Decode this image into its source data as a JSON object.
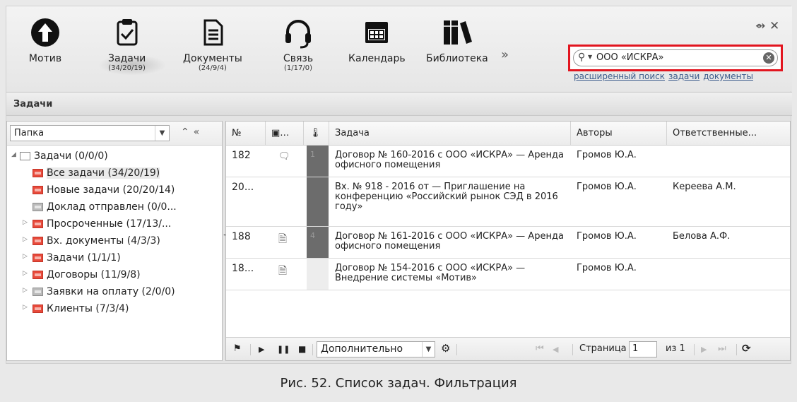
{
  "toolbar": {
    "buttons": [
      {
        "label": "Мотив",
        "count": ""
      },
      {
        "label": "Задачи",
        "count": "(34/20/19)"
      },
      {
        "label": "Документы",
        "count": "(24/9/4)"
      },
      {
        "label": "Связь",
        "count": "(1/17/0)"
      },
      {
        "label": "Календарь",
        "count": ""
      },
      {
        "label": "Библиотека",
        "count": ""
      }
    ],
    "more": "»",
    "pin": "⇴",
    "close": "✕"
  },
  "search": {
    "value": "ООО «ИСКРА»",
    "links": [
      "расширенный поиск",
      "задачи",
      "документы"
    ]
  },
  "section_title": "Задачи",
  "folder": {
    "select_value": "Папка",
    "tree": [
      {
        "label": "Задачи (0/0/0)"
      },
      {
        "label": "Все задачи (34/20/19)"
      },
      {
        "label": "Новые задачи (20/20/14)"
      },
      {
        "label": "Доклад отправлен (0/0..."
      },
      {
        "label": "Просроченные (17/13/..."
      },
      {
        "label": "Вх. документы (4/3/3)"
      },
      {
        "label": "Задачи (1/1/1)"
      },
      {
        "label": "Договоры (11/9/8)"
      },
      {
        "label": "Заявки на оплату (2/0/0)"
      },
      {
        "label": "Клиенты (7/3/4)"
      }
    ]
  },
  "grid": {
    "headers": {
      "num": "№",
      "type": "…",
      "task": "Задача",
      "authors": "Авторы",
      "responsible": "Ответственные..."
    },
    "rows": [
      {
        "num": "182",
        "prio": "1",
        "task": "Договор № 160-2016 с ООО «ИСКРА» — Аренда офисного помещения",
        "author": "Громов Ю.А.",
        "resp": ""
      },
      {
        "num": "20...",
        "prio": "",
        "task": "Вх. № 918 - 2016 от — Приглашение на конференцию «Российский рынок СЭД в 2016 году»",
        "author": "Громов Ю.А.",
        "resp": "Кереева А.М."
      },
      {
        "num": "188",
        "prio": "4",
        "task": "Договор № 161-2016 с ООО «ИСКРА» — Аренда офисного помещения",
        "author": "Громов Ю.А.",
        "resp": "Белова А.Ф."
      },
      {
        "num": "18...",
        "prio": "",
        "task": "Договор № 154-2016 с ООО «ИСКРА» — Внедрение системы «Мотив»",
        "author": "Громов Ю.А.",
        "resp": ""
      }
    ],
    "footer": {
      "more_select": "Дополнительно",
      "page_label": "Страница",
      "page_value": "1",
      "of_label": "из 1"
    }
  },
  "caption": "Рис. 52. Список задач. Фильтрация",
  "colors": {
    "highlight": "#e2151f",
    "folder_red": "#e84a3b",
    "priority_dark": "#6c6c6c"
  }
}
